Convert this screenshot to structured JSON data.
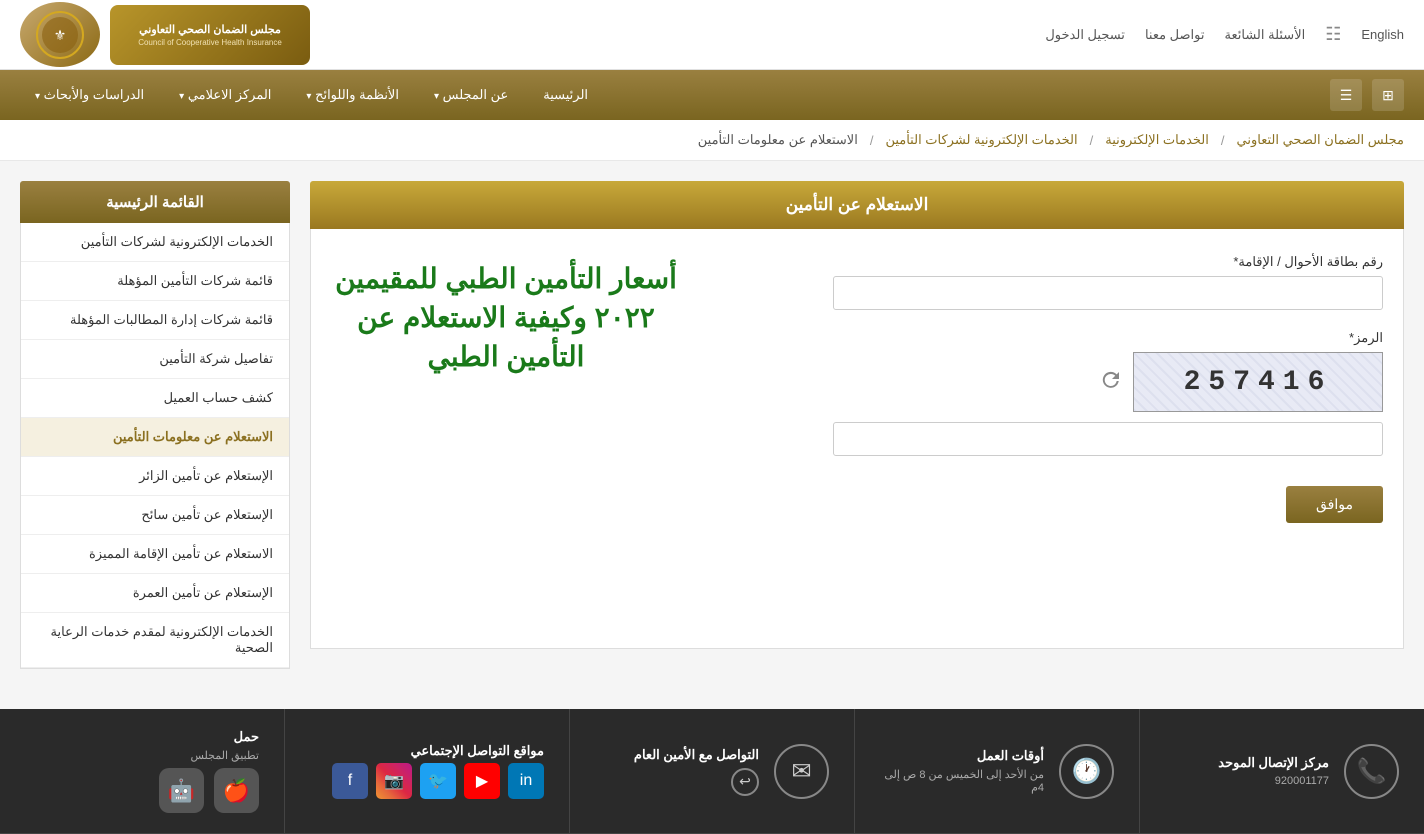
{
  "topbar": {
    "english_label": "English",
    "sitemap_label": "خريطة الموقع",
    "faq_label": "الأسئلة الشائعة",
    "contact_label": "تواصل معنا",
    "register_label": "تسجيل الدخول"
  },
  "logo": {
    "main_text_ar": "مجلس الضمان الصحي التعاوني",
    "main_text_en": "Council of Cooperative Health Insurance"
  },
  "nav": {
    "home": "الرئيسية",
    "about": "عن المجلس",
    "regulations": "الأنظمة واللوائح",
    "media": "المركز الاعلامي",
    "research": "الدراسات والأبحاث"
  },
  "breadcrumb": {
    "item1": "مجلس الضمان الصحي التعاوني",
    "item2": "الخدمات الإلكترونية",
    "item3": "الخدمات الإلكترونية لشركات التأمين",
    "item4": "الاستعلام عن معلومات التأمين"
  },
  "sidebar": {
    "title": "القائمة الرئيسية",
    "items": [
      "الخدمات الإلكترونية لشركات التأمين",
      "قائمة شركات التأمين المؤهلة",
      "قائمة شركات إدارة المطالبات المؤهلة",
      "تفاصيل شركة التأمين",
      "كشف حساب العميل",
      "الاستعلام عن معلومات التأمين",
      "الإستعلام عن تأمين الزائر",
      "الإستعلام عن تأمين سائح",
      "الاستعلام عن تأمين الإقامة المميزة",
      "الإستعلام عن تأمين العمرة",
      "الخدمات الإلكترونية لمقدم خدمات الرعاية الصحية"
    ]
  },
  "form": {
    "title": "الاستعلام عن التأمين",
    "id_label": "رقم بطاقة الأحوال / الإقامة*",
    "id_placeholder": "",
    "captcha_label": "الرمز*",
    "captcha_value": "257416",
    "captcha_input_placeholder": "",
    "submit_label": "موافق",
    "overlay_text": "أسعار التأمين الطبي للمقيمين ٢٠٢٢ وكيفية الاستعلام عن التأمين الطبي"
  },
  "footer": {
    "contact_title": "مركز الإتصال الموحد",
    "contact_number": "920001177",
    "hours_title": "أوقات العمل",
    "hours_desc": "من الأحد إلى الخميس من 8 ص إلى 4م",
    "social_title": "التواصل مع الأمين العام",
    "social_media_title": "مواقع التواصل الإجتماعي",
    "download_title": "حمل",
    "download_subtitle": "تطبيق المجلس",
    "social_icons": [
      "in",
      "yt",
      "tw",
      "ig",
      "fb"
    ]
  }
}
